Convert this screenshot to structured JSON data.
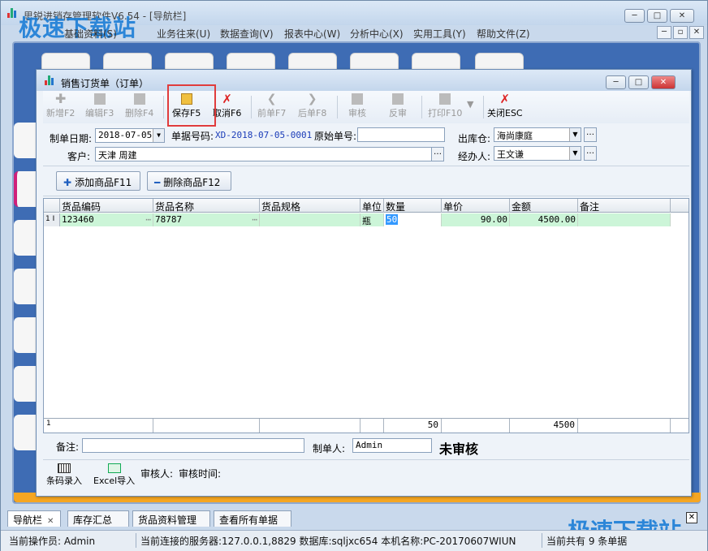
{
  "main_window": {
    "title": "思锐进销存管理软件V6.54 - [导航栏]",
    "window_buttons": [
      "─",
      "□",
      "✕"
    ],
    "mdi_buttons": [
      "─",
      "▫",
      "✕"
    ]
  },
  "watermarks": [
    "极速下载站",
    "极速下载站"
  ],
  "menubar": [
    "基础资料(S)",
    "业务往来(U)",
    "数据查询(V)",
    "报表中心(W)",
    "分析中心(X)",
    "实用工具(Y)",
    "帮助文件(Z)"
  ],
  "child_window": {
    "title": "销售订货单（订单）",
    "window_buttons": [
      "─",
      "□",
      "✕"
    ]
  },
  "toolbar": {
    "new": "新增F2",
    "edit": "编辑F3",
    "delete": "删除F4",
    "save": "保存F5",
    "cancel": "取消F6",
    "prev": "前单F7",
    "next": "后单F8",
    "audit": "审核",
    "unaudit": "反审",
    "print": "打印F10",
    "close": "关闭ESC"
  },
  "form": {
    "date_label": "制单日期:",
    "date_value": "2018-07-05",
    "order_no_label": "单据号码:",
    "order_no_value": "XD-2018-07-05-0001",
    "orig_no_label": "原始单号:",
    "orig_no_value": "",
    "warehouse_label": "出库仓:",
    "warehouse_value": "海尚康庭",
    "customer_label": "客户:",
    "customer_value": "天津    周建",
    "handler_label": "经办人:",
    "handler_value": "王文谦"
  },
  "goods_buttons": {
    "add": "添加商品F11",
    "remove": "删除商品F12"
  },
  "grid": {
    "columns": [
      "货品编码",
      "货品名称",
      "货品规格",
      "单位",
      "数量",
      "单价",
      "金额",
      "备注"
    ],
    "rows": [
      {
        "num": "1",
        "code": "123460",
        "name": "78787",
        "spec": "",
        "unit": "瓶",
        "qty": "50",
        "price": "90.00",
        "amount": "4500.00",
        "note": ""
      }
    ],
    "summary": {
      "count": "1",
      "qty": "50",
      "amount": "4500"
    }
  },
  "footer": {
    "remark_label": "备注:",
    "remark_value": "",
    "maker_label": "制单人:",
    "maker_value": "Admin",
    "status": "未审核",
    "barcode": "条码录入",
    "excel": "Excel导入",
    "auditor_label": "审核人:",
    "audit_time_label": "审核时间:"
  },
  "tabs": [
    "导航栏",
    "库存汇总",
    "货品资料管理",
    "查看所有单据"
  ],
  "tab_close": "✕",
  "statusbar": {
    "operator": "当前操作员: Admin",
    "server": "当前连接的服务器:127.0.0.1,8829 数据库:sqljxc654 本机名称:PC-20170607WIUN",
    "count": "当前共有 9 条单据"
  }
}
